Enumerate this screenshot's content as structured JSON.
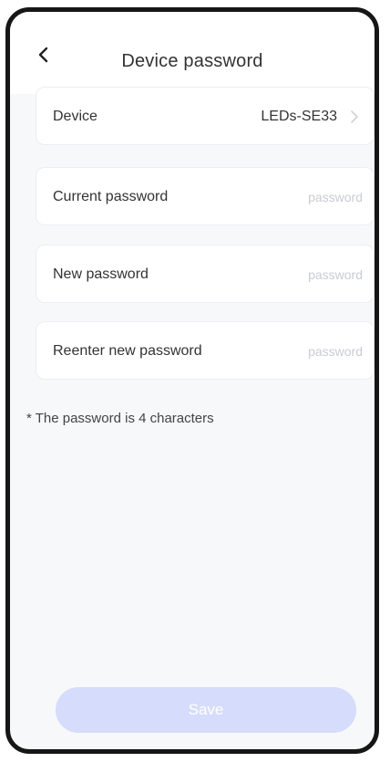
{
  "header": {
    "title": "Device password",
    "back_icon": "chevron-left-icon"
  },
  "device": {
    "label": "Device",
    "value": "LEDs-SE33",
    "arrow_icon": "chevron-right-icon"
  },
  "fields": {
    "current": {
      "label": "Current password",
      "placeholder": "password",
      "value": ""
    },
    "new": {
      "label": "New password",
      "placeholder": "password",
      "value": ""
    },
    "reenter": {
      "label": "Reenter new password",
      "placeholder": "password",
      "value": ""
    }
  },
  "note": "* The password is 4 characters",
  "save_button": {
    "label": "Save",
    "enabled": false
  },
  "colors": {
    "background": "#f7f8fa",
    "text": "#333333",
    "placeholder": "#c9ccd2",
    "save_button_disabled": "#d6dcfb",
    "frame": "#161616"
  }
}
